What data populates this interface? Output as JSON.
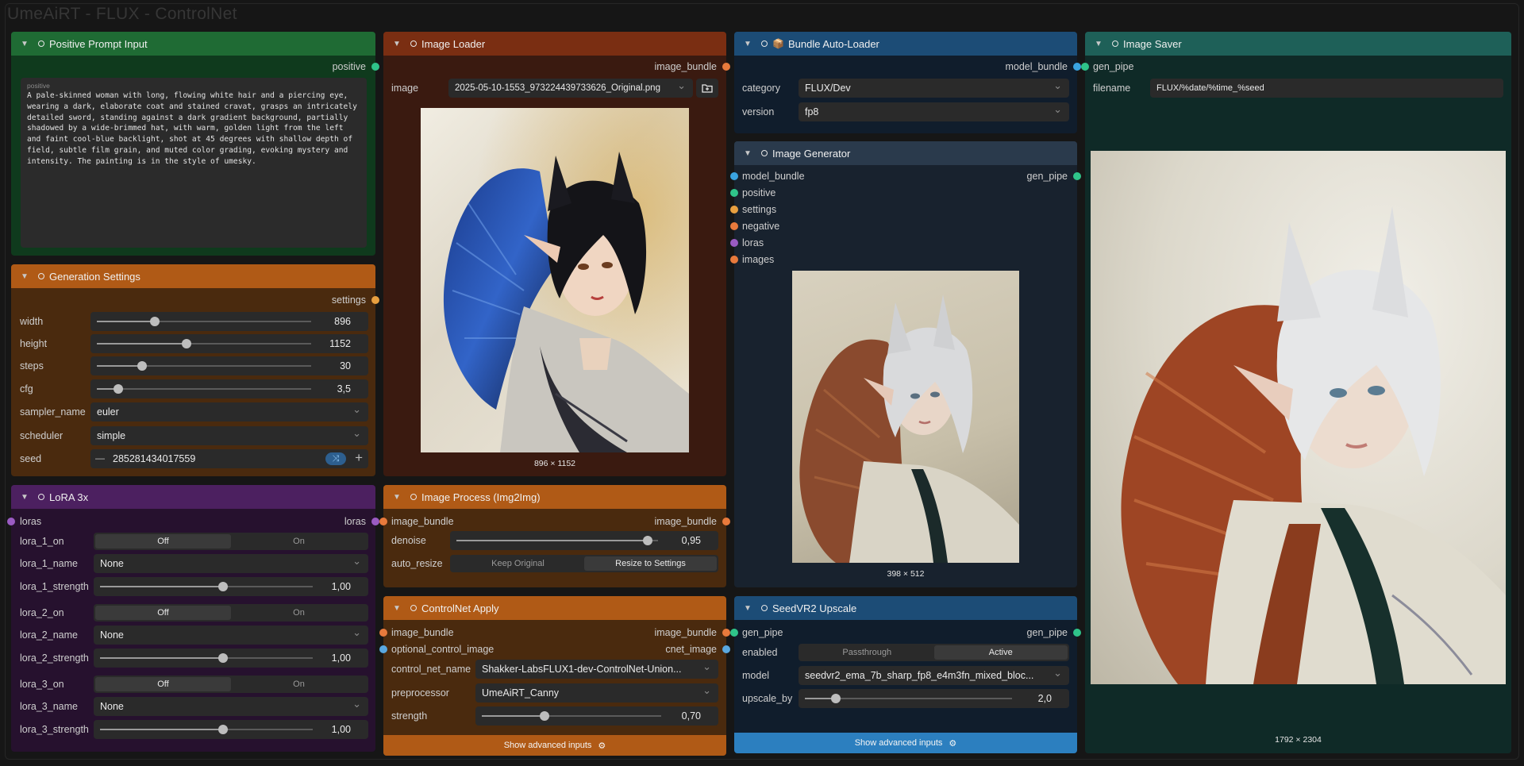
{
  "window_title": "UmeAiRT - FLUX - ControlNet",
  "positive_prompt": {
    "title": "Positive Prompt Input",
    "output": "positive",
    "field_label": "positive",
    "text": "A pale-skinned woman with long, flowing white hair and a piercing eye, wearing a dark, elaborate coat and stained cravat, grasps an intricately detailed sword, standing against a dark gradient background, partially shadowed by a wide-brimmed hat, with warm, golden light from the left and faint cool-blue backlight, shot at 45 degrees with shallow depth of field, subtle film grain, and muted color grading, evoking mystery and intensity. The painting is in the style of umesky."
  },
  "generation_settings": {
    "title": "Generation Settings",
    "output": "settings",
    "width_label": "width",
    "width": "896",
    "width_fraction": 0.27,
    "height_label": "height",
    "height": "1152",
    "height_fraction": 0.42,
    "steps_label": "steps",
    "steps": "30",
    "steps_fraction": 0.21,
    "cfg_label": "cfg",
    "cfg": "3,5",
    "cfg_fraction": 0.1,
    "sampler_label": "sampler_name",
    "sampler": "euler",
    "scheduler_label": "scheduler",
    "scheduler": "simple",
    "seed_label": "seed",
    "seed": "285281434017559",
    "seed_minus": "—",
    "seed_plus": "+"
  },
  "lora": {
    "title": "LoRA 3x",
    "input": "loras",
    "output": "loras",
    "off": "Off",
    "on": "On",
    "lora_1_on": "lora_1_on",
    "lora_1_name_label": "lora_1_name",
    "lora_1_name": "None",
    "lora_1_strength_label": "lora_1_strength",
    "lora_1_strength": "1,00",
    "lora_2_on": "lora_2_on",
    "lora_2_name_label": "lora_2_name",
    "lora_2_name": "None",
    "lora_2_strength_label": "lora_2_strength",
    "lora_2_strength": "1,00",
    "lora_3_on": "lora_3_on",
    "lora_3_name_label": "lora_3_name",
    "lora_3_name": "None",
    "lora_3_strength_label": "lora_3_strength",
    "lora_3_strength": "1,00",
    "strength_fraction": 0.58
  },
  "image_loader": {
    "title": "Image Loader",
    "output": "image_bundle",
    "image_label": "image",
    "image_file": "2025-05-10-1553_973224439733626_Original.png",
    "caption": "896 × 1152"
  },
  "image_process": {
    "title": "Image Process (Img2Img)",
    "input": "image_bundle",
    "output": "image_bundle",
    "denoise_label": "denoise",
    "denoise": "0,95",
    "denoise_fraction": 0.95,
    "auto_resize_label": "auto_resize",
    "auto_resize_options": [
      "Keep Original",
      "Resize to Settings"
    ]
  },
  "controlnet": {
    "title": "ControlNet Apply",
    "input1": "image_bundle",
    "output1": "image_bundle",
    "input2": "optional_control_image",
    "output2": "cnet_image",
    "control_net_name_label": "control_net_name",
    "control_net_name": "Shakker-LabsFLUX1-dev-ControlNet-Union...",
    "preprocessor_label": "preprocessor",
    "preprocessor": "UmeAiRT_Canny",
    "strength_label": "strength",
    "strength": "0,70",
    "strength_fraction": 0.35,
    "advanced": "Show advanced inputs"
  },
  "bundle_loader": {
    "title": "Bundle Auto-Loader",
    "output": "model_bundle",
    "category_label": "category",
    "category": "FLUX/Dev",
    "version_label": "version",
    "version": "fp8"
  },
  "image_generator": {
    "title": "Image Generator",
    "inputs": [
      "model_bundle",
      "positive",
      "settings",
      "negative",
      "loras",
      "images"
    ],
    "output": "gen_pipe",
    "caption": "398 × 512"
  },
  "upscale": {
    "title": "SeedVR2 Upscale",
    "input": "gen_pipe",
    "output": "gen_pipe",
    "enabled_label": "enabled",
    "enabled_options": [
      "Passthrough",
      "Active"
    ],
    "model_label": "model",
    "model": "seedvr2_ema_7b_sharp_fp8_e4m3fn_mixed_bloc...",
    "upscale_by_label": "upscale_by",
    "upscale_by": "2,0",
    "upscale_fraction": 0.15,
    "advanced": "Show advanced inputs"
  },
  "image_saver": {
    "title": "Image Saver",
    "input": "gen_pipe",
    "filename_label": "filename",
    "filename": "FLUX/%date/%time_%seed",
    "caption": "1792 × 2304"
  },
  "colors": {
    "green_header": "#1f6b34",
    "orange_header": "#b05a16",
    "brown_header": "#7a2e12",
    "purple_header": "#4c2060",
    "blue_header": "#1c4c76",
    "teal_header": "#1e6058",
    "button_blue": "#2c7fbf"
  }
}
